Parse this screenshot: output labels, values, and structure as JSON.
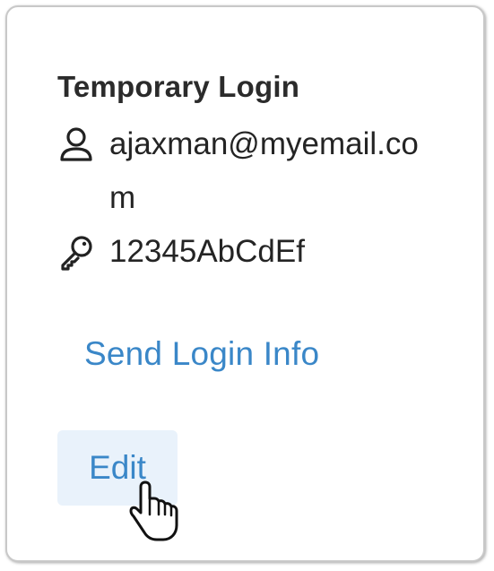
{
  "login": {
    "title": "Temporary Login",
    "email": "ajaxman@myemail.com",
    "password": "12345AbCdEf",
    "send_label": "Send Login Info",
    "edit_label": "Edit"
  },
  "icons": {
    "user": "user-icon",
    "key": "key-icon",
    "cursor": "hand-pointer-cursor-icon"
  },
  "colors": {
    "link": "#3a87c8",
    "button_bg": "#e9f2fb",
    "text": "#242424",
    "border": "#c8c8c8"
  }
}
